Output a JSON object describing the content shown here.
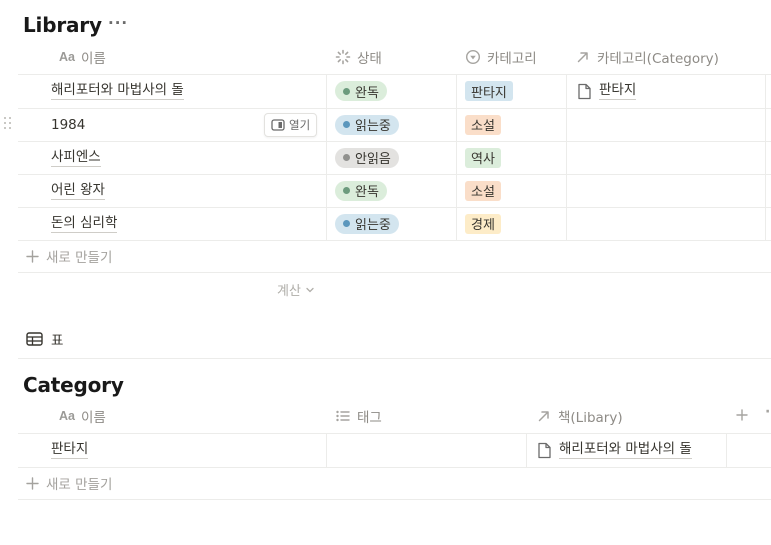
{
  "library": {
    "title": "Library",
    "more_icon": "more-horizontal-icon",
    "columns": [
      {
        "label": "이름",
        "icon": "Aa"
      },
      {
        "label": "상태",
        "icon": "status-icon"
      },
      {
        "label": "카테고리",
        "icon": "select-icon"
      },
      {
        "label": "카테고리(Category)",
        "icon": "relation-arrow-icon"
      }
    ],
    "rows": [
      {
        "name": "해리포터와 마법사의 돌",
        "status": "완독",
        "category": "판타지",
        "relation": "판타지"
      },
      {
        "name": "1984",
        "status": "읽는중",
        "category": "소설",
        "relation": ""
      },
      {
        "name": "사피엔스",
        "status": "안읽음",
        "category": "역사",
        "relation": ""
      },
      {
        "name": "어린 왕자",
        "status": "완독",
        "category": "소설",
        "relation": ""
      },
      {
        "name": "돈의 심리학",
        "status": "읽는중",
        "category": "경제",
        "relation": ""
      }
    ],
    "open_button": "열기",
    "new_row": "새로 만들기",
    "calculate": "계산",
    "view_label": "표"
  },
  "category": {
    "title": "Category",
    "columns": [
      {
        "label": "이름",
        "icon": "Aa"
      },
      {
        "label": "태그",
        "icon": "list-icon"
      },
      {
        "label": "책(Libary)",
        "icon": "relation-arrow-icon"
      }
    ],
    "rows": [
      {
        "name": "판타지",
        "tag": "",
        "books": "해리포터와 마법사의 돌"
      }
    ],
    "new_row": "새로 만들기"
  },
  "colors": {
    "status_done_bg": "#dbeddb",
    "status_done_dot": "#6c9b7d",
    "status_reading_bg": "#d3e5ef",
    "status_reading_dot": "#5b97bd",
    "status_unread_bg": "#e3e2e0",
    "status_unread_dot": "#91918e",
    "cat_fantasy_bg": "#d3e5ef",
    "cat_novel_bg": "#fadec9",
    "cat_history_bg": "#dbeddb",
    "cat_economy_bg": "#fdecc8"
  }
}
